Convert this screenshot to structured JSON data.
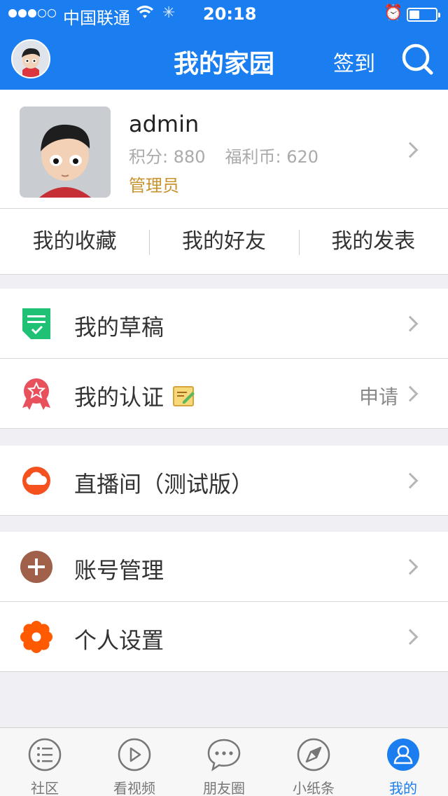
{
  "status_bar": {
    "carrier": "中国联通",
    "time": "20:18",
    "signal_bars_filled": 3,
    "signal_bars_total": 5,
    "battery_percent": 30,
    "icons": [
      "wifi-icon",
      "activity-spinner-icon",
      "alarm-icon",
      "battery-icon"
    ]
  },
  "navbar": {
    "title": "我的家园",
    "checkin": "签到",
    "search_icon": "search-icon",
    "background": "#1a7ef0"
  },
  "profile": {
    "username": "admin",
    "points_label": "积分: 880",
    "coins_label": "福利币: 620",
    "role": "管理员"
  },
  "quick_links": [
    {
      "label": "我的收藏"
    },
    {
      "label": "我的好友"
    },
    {
      "label": "我的发表"
    }
  ],
  "menu": {
    "drafts": {
      "label": "我的草稿",
      "icon": "draft-icon",
      "color": "#1fc275"
    },
    "certification": {
      "label": "我的认证",
      "icon": "badge-icon",
      "extra": "申请",
      "color": "#e8515c"
    },
    "live": {
      "label": "直播间（测试版）",
      "icon": "cloud-icon",
      "color": "#f4511e"
    },
    "account": {
      "label": "账号管理",
      "icon": "plus-circle-icon",
      "color": "#a0604a"
    },
    "settings": {
      "label": "个人设置",
      "icon": "gear-icon",
      "color": "#ff5a00"
    }
  },
  "tabbar": {
    "tabs": [
      {
        "label": "社区",
        "icon": "list-icon",
        "active": false
      },
      {
        "label": "看视频",
        "icon": "play-icon",
        "active": false
      },
      {
        "label": "朋友圈",
        "icon": "chat-icon",
        "active": false
      },
      {
        "label": "小纸条",
        "icon": "compass-icon",
        "active": false
      },
      {
        "label": "我的",
        "icon": "user-icon",
        "active": true
      }
    ],
    "active_color": "#1a7ef0"
  }
}
